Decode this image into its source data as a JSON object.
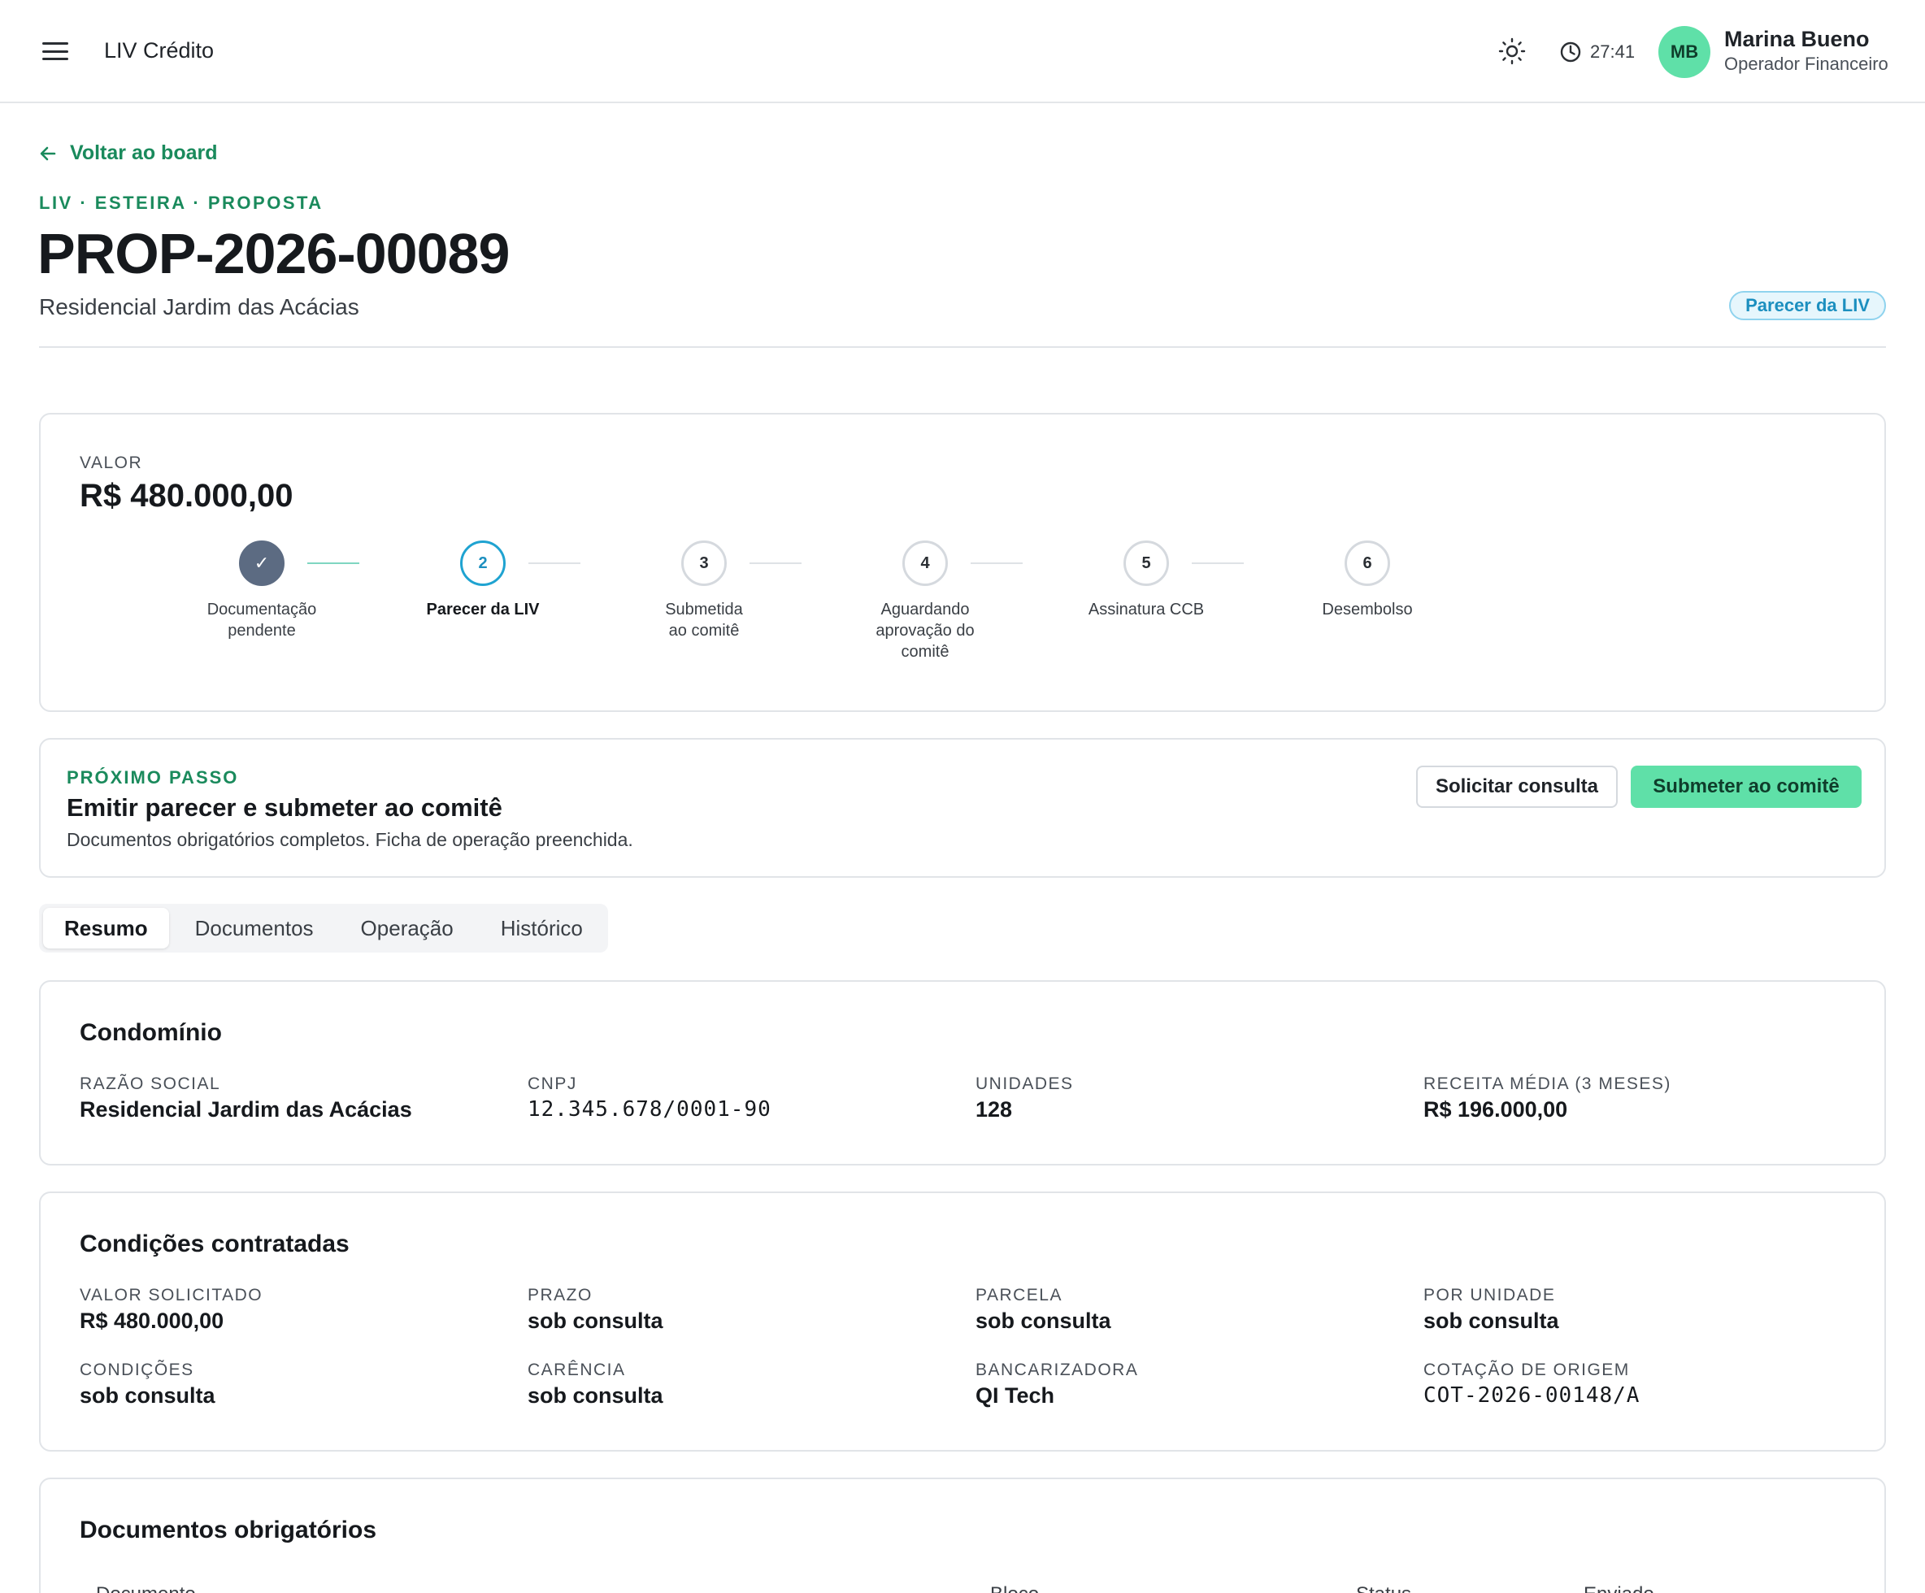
{
  "app": {
    "title": "LIV Crédito"
  },
  "topbar": {
    "timer": "27:41",
    "user": {
      "initials": "MB",
      "name": "Marina Bueno",
      "role": "Operador Financeiro"
    }
  },
  "header": {
    "back_label": "Voltar ao board",
    "breadcrumb": "LIV · ESTEIRA · PROPOSTA",
    "title": "PROP-2026-00089",
    "subtitle": "Residencial Jardim das Acácias",
    "status_badge": "Parecer da LIV"
  },
  "summary": {
    "value_label": "VALOR",
    "value": "R$ 480.000,00",
    "steps": [
      {
        "marker": "✓",
        "label": "Documentação pendente",
        "state": "done"
      },
      {
        "marker": "2",
        "label": "Parecer da LIV",
        "state": "active"
      },
      {
        "marker": "3",
        "label": "Submetida ao comitê",
        "state": "pending"
      },
      {
        "marker": "4",
        "label": "Aguardando aprovação do comitê",
        "state": "pending"
      },
      {
        "marker": "5",
        "label": "Assinatura CCB",
        "state": "pending"
      },
      {
        "marker": "6",
        "label": "Desembolso",
        "state": "pending"
      }
    ]
  },
  "next_step": {
    "label": "PRÓXIMO PASSO",
    "title": "Emitir parecer e submeter ao comitê",
    "description": "Documentos obrigatórios completos. Ficha de operação preenchida.",
    "secondary_action": "Solicitar consulta",
    "primary_action": "Submeter ao comitê"
  },
  "tabs": [
    {
      "label": "Resumo",
      "active": true
    },
    {
      "label": "Documentos",
      "active": false
    },
    {
      "label": "Operação",
      "active": false
    },
    {
      "label": "Histórico",
      "active": false
    }
  ],
  "condominio": {
    "title": "Condomínio",
    "fields": [
      {
        "label": "RAZÃO SOCIAL",
        "value": "Residencial Jardim das Acácias"
      },
      {
        "label": "CNPJ",
        "value": "12.345.678/0001-90"
      },
      {
        "label": "UNIDADES",
        "value": "128"
      },
      {
        "label": "RECEITA MÉDIA (3 MESES)",
        "value": "R$ 196.000,00"
      }
    ]
  },
  "condicoes": {
    "title": "Condições contratadas",
    "fields": [
      {
        "label": "VALOR SOLICITADO",
        "value": "R$ 480.000,00"
      },
      {
        "label": "PRAZO",
        "value": "sob consulta"
      },
      {
        "label": "PARCELA",
        "value": "sob consulta"
      },
      {
        "label": "POR UNIDADE",
        "value": "sob consulta"
      },
      {
        "label": "CONDIÇÕES",
        "value": "sob consulta"
      },
      {
        "label": "CARÊNCIA",
        "value": "sob consulta"
      },
      {
        "label": "BANCARIZADORA",
        "value": "QI Tech"
      },
      {
        "label": "COTAÇÃO DE ORIGEM",
        "value": "COT-2026-00148/A"
      }
    ]
  },
  "documentos": {
    "title": "Documentos obrigatórios",
    "columns": [
      "Documento",
      "Bloco",
      "Status",
      "Enviado"
    ]
  },
  "colors": {
    "accent": "#1a8a5c",
    "primary_button": "#5fe0a8",
    "status_badge": "#1c8fbf",
    "step_done": "#5c6b82"
  }
}
